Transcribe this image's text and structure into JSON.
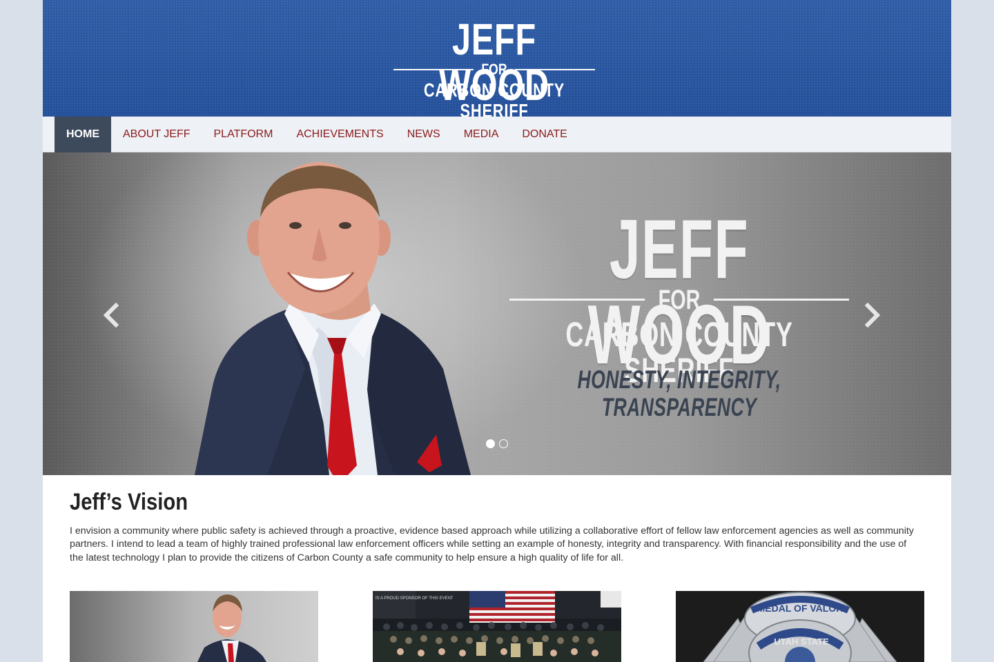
{
  "header": {
    "logo_name": "JEFF WOOD",
    "logo_for": "FOR",
    "logo_sub": "CARBON COUNTY SHERIFF"
  },
  "nav": {
    "items": [
      {
        "label": "HOME",
        "active": true
      },
      {
        "label": "ABOUT JEFF"
      },
      {
        "label": "PLATFORM"
      },
      {
        "label": "ACHIEVEMENTS"
      },
      {
        "label": "NEWS"
      },
      {
        "label": "MEDIA"
      },
      {
        "label": "DONATE"
      }
    ]
  },
  "hero": {
    "name": "JEFF WOOD",
    "for": "FOR",
    "sub": "CARBON COUNTY SHERIFF",
    "tagline": "HONESTY, INTEGRITY, TRANSPARENCY",
    "slide_count": 2,
    "active_slide": 1,
    "prev_icon": "chevron-left-icon",
    "next_icon": "chevron-right-icon"
  },
  "vision": {
    "title": "Jeff’s Vision",
    "text": "I envision a community where public safety is achieved through a proactive, evidence based approach while utilizing a collaborative effort of fellow law enforcement agencies as well as community partners. I intend to lead a team of highly trained professional law enforcement officers while setting an example of honesty, integrity and transparency. With financial responsibility and the use of the latest technology I plan to provide the citizens of Carbon County a safe community to help ensure a high quality of life for all."
  },
  "thumbnails": {
    "badge_text": "MEDAL OF VALOR",
    "badge_state": "UTAH STATE",
    "banner_text": "IS A PROUD SPONSOR OF THIS EVENT"
  },
  "colors": {
    "header_blue": "#2a57a0",
    "nav_active": "#3d4a5c",
    "nav_link": "#8b1a1a",
    "tagline": "#3a4351",
    "page_bg": "#d9e0ea"
  }
}
